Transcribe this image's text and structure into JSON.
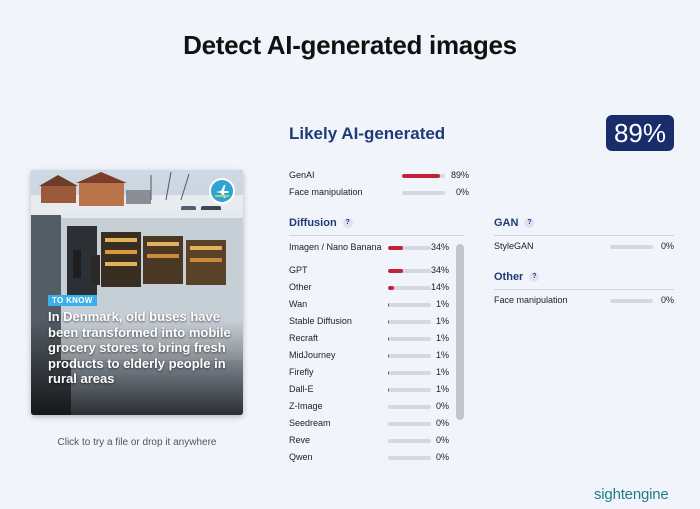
{
  "page": {
    "title": "Detect AI-generated images"
  },
  "preview": {
    "tag": "TO KNOW",
    "headline": "In Denmark, old buses have been transformed into mobile grocery stores to bring fresh products to elderly people in rural areas",
    "hint": "Click to try a file or drop it anywhere"
  },
  "result": {
    "verdict": "Likely AI-generated",
    "score": "89%",
    "score_value": 89
  },
  "summary": [
    {
      "label": "GenAI",
      "pct": "89%",
      "value": 89
    },
    {
      "label": "Face manipulation",
      "pct": "0%",
      "value": 0
    }
  ],
  "diffusion": {
    "title": "Diffusion",
    "help": "?",
    "items": [
      {
        "label": "Imagen / Nano Banana",
        "pct": "34%",
        "value": 34
      },
      {
        "label": "GPT",
        "pct": "34%",
        "value": 34
      },
      {
        "label": "Other",
        "pct": "14%",
        "value": 14
      },
      {
        "label": "Wan",
        "pct": "1%",
        "value": 1
      },
      {
        "label": "Stable Diffusion",
        "pct": "1%",
        "value": 1
      },
      {
        "label": "Recraft",
        "pct": "1%",
        "value": 1
      },
      {
        "label": "MidJourney",
        "pct": "1%",
        "value": 1
      },
      {
        "label": "Firefly",
        "pct": "1%",
        "value": 1
      },
      {
        "label": "Dall-E",
        "pct": "1%",
        "value": 1
      },
      {
        "label": "Z-Image",
        "pct": "0%",
        "value": 0
      },
      {
        "label": "Seedream",
        "pct": "0%",
        "value": 0
      },
      {
        "label": "Reve",
        "pct": "0%",
        "value": 0
      },
      {
        "label": "Qwen",
        "pct": "0%",
        "value": 0
      }
    ]
  },
  "gan": {
    "title": "GAN",
    "help": "?",
    "items": [
      {
        "label": "StyleGAN",
        "pct": "0%",
        "value": 0
      }
    ]
  },
  "other": {
    "title": "Other",
    "help": "?",
    "items": [
      {
        "label": "Face manipulation",
        "pct": "0%",
        "value": 0
      }
    ]
  },
  "brand": {
    "logo": "sightengine"
  },
  "colors": {
    "accent": "#1a2d6b",
    "bar_fill": "#c3233a",
    "bar_track": "#d5d8e0"
  }
}
